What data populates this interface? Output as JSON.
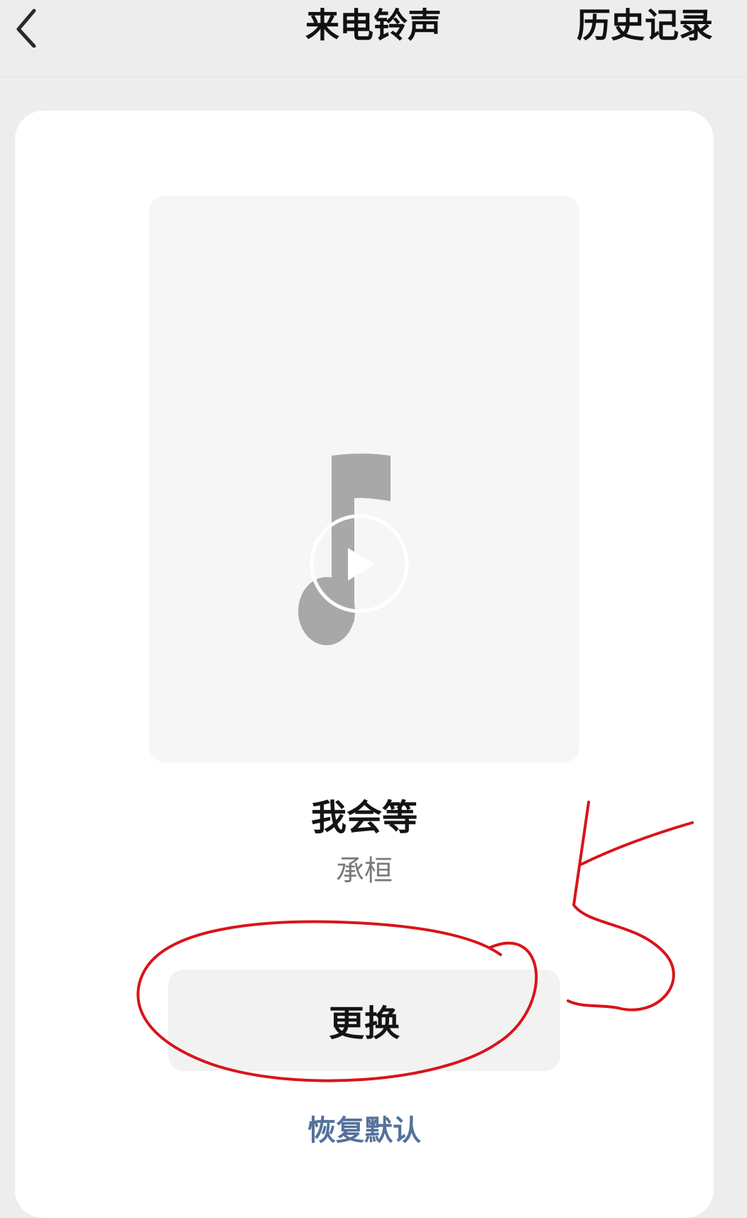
{
  "header": {
    "title": "来电铃声",
    "history_label": "历史记录",
    "back_icon": "chevron-left-icon"
  },
  "cover": {
    "placeholder_icon": "music-note-icon",
    "play_icon": "play-icon"
  },
  "song": {
    "title": "我会等",
    "artist": "承桓"
  },
  "actions": {
    "change_label": "更换",
    "restore_label": "恢复默认"
  },
  "annotation": {
    "number": "5",
    "color": "#d8141b"
  },
  "colors": {
    "background": "#ededed",
    "card": "#ffffff",
    "link": "#55719b",
    "annotation_red": "#d8141b"
  }
}
